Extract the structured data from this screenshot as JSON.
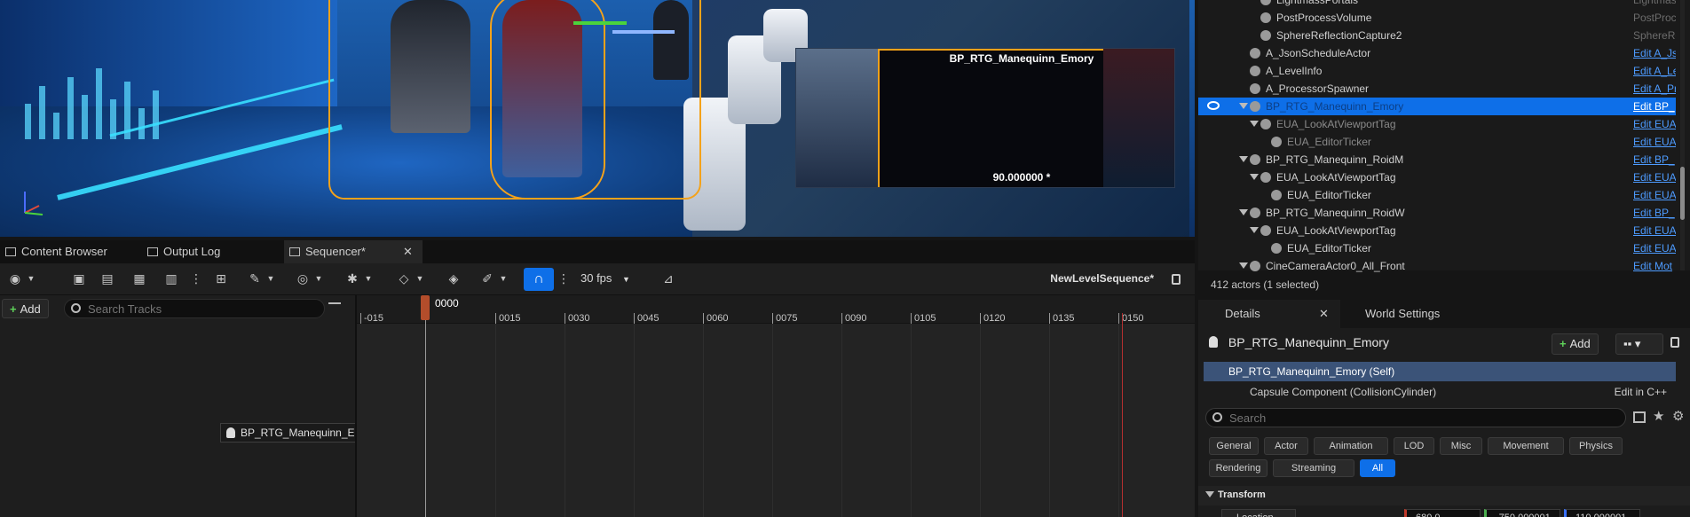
{
  "viewport": {
    "preview_title": "BP_RTG_Manequinn_Emory",
    "preview_value": "90.000000 *"
  },
  "outliner": {
    "rows": [
      {
        "name": "LightmassPortals",
        "type": "Lightmas"
      },
      {
        "name": "PostProcessVolume",
        "type": "PostProc"
      },
      {
        "name": "SphereReflectionCapture2",
        "type": "SphereRe"
      },
      {
        "name": "A_JsonScheduleActor",
        "type": "Edit A_Js"
      },
      {
        "name": "A_LevelInfo",
        "type": "Edit A_Le"
      },
      {
        "name": "A_ProcessorSpawner",
        "type": "Edit A_Pr"
      },
      {
        "name": "BP_RTG_Manequinn_Emory",
        "type": "Edit BP_"
      },
      {
        "name": "EUA_LookAtViewportTag",
        "type": "Edit EUA"
      },
      {
        "name": "EUA_EditorTicker",
        "type": "Edit EUA"
      },
      {
        "name": "BP_RTG_Manequinn_RoidM",
        "type": "Edit BP_"
      },
      {
        "name": "EUA_LookAtViewportTag",
        "type": "Edit EUA"
      },
      {
        "name": "EUA_EditorTicker",
        "type": "Edit EUA"
      },
      {
        "name": "BP_RTG_Manequinn_RoidW",
        "type": "Edit BP_"
      },
      {
        "name": "EUA_LookAtViewportTag",
        "type": "Edit EUA"
      },
      {
        "name": "EUA_EditorTicker",
        "type": "Edit EUA"
      },
      {
        "name": "CineCameraActor0_All_Front",
        "type": "Edit Mot"
      }
    ],
    "actor_count": "412 actors (1 selected)"
  },
  "details": {
    "tab_details": "Details",
    "tab_world": "World Settings",
    "header": "BP_RTG_Manequinn_Emory",
    "add_label": "Add",
    "component_self": "BP_RTG_Manequinn_Emory (Self)",
    "component_capsule": "Capsule Component (CollisionCylinder)",
    "edit_cpp": "Edit in C++",
    "search_placeholder": "Search",
    "categories": [
      "General",
      "Actor",
      "Animation",
      "LOD",
      "Misc",
      "Movement",
      "Physics",
      "Rendering",
      "Streaming",
      "All"
    ],
    "section_transform": "Transform",
    "location_label": "Location",
    "location_x": "680.0",
    "location_y": "-750.000001",
    "location_z": "110.000001"
  },
  "sequencer": {
    "tabs": [
      "Content Browser",
      "Output Log",
      "Sequencer*"
    ],
    "add_label": "Add",
    "search_placeholder": "Search Tracks",
    "fps": "30 fps",
    "sequence_name": "NewLevelSequence*",
    "playhead_frame": "0000",
    "track_name": "BP_RTG_Manequinn_Emory",
    "ruler_labels": [
      "-015",
      "0015",
      "0030",
      "0045",
      "0060",
      "0075",
      "0090",
      "0105",
      "0120",
      "0135",
      "0150"
    ]
  },
  "colors": {
    "selection": "#0e6fe8",
    "link": "#4d9bff",
    "outline": "#f4a21a",
    "end_marker": "#b33030"
  }
}
